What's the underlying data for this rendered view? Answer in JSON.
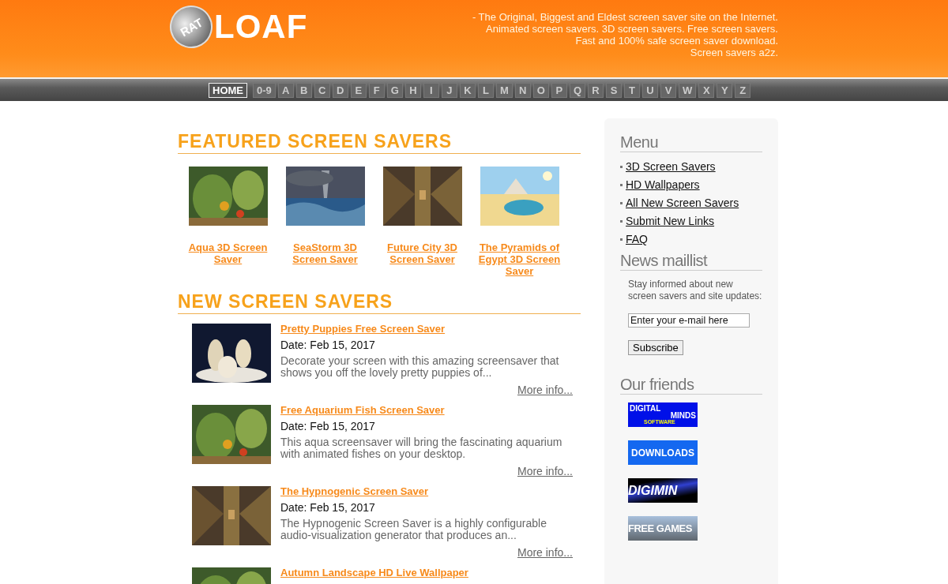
{
  "logo": {
    "badge": "RAT",
    "word": "LOAF"
  },
  "tagline": [
    "- The Original, Biggest and Eldest screen saver site on the Internet.",
    "Animated screen savers. 3D screen savers. Free screen savers.",
    "Fast and 100% safe screen saver download.",
    "Screen savers a2z."
  ],
  "nav": [
    {
      "label": "HOME",
      "selected": true
    },
    {
      "label": "0-9",
      "selected": false
    },
    {
      "label": "A",
      "selected": false
    },
    {
      "label": "B",
      "selected": false
    },
    {
      "label": "C",
      "selected": false
    },
    {
      "label": "D",
      "selected": false
    },
    {
      "label": "E",
      "selected": false
    },
    {
      "label": "F",
      "selected": false
    },
    {
      "label": "G",
      "selected": false
    },
    {
      "label": "H",
      "selected": false
    },
    {
      "label": "I",
      "selected": false
    },
    {
      "label": "J",
      "selected": false
    },
    {
      "label": "K",
      "selected": false
    },
    {
      "label": "L",
      "selected": false
    },
    {
      "label": "M",
      "selected": false
    },
    {
      "label": "N",
      "selected": false
    },
    {
      "label": "O",
      "selected": false
    },
    {
      "label": "P",
      "selected": false
    },
    {
      "label": "Q",
      "selected": false
    },
    {
      "label": "R",
      "selected": false
    },
    {
      "label": "S",
      "selected": false
    },
    {
      "label": "T",
      "selected": false
    },
    {
      "label": "U",
      "selected": false
    },
    {
      "label": "V",
      "selected": false
    },
    {
      "label": "W",
      "selected": false
    },
    {
      "label": "X",
      "selected": false
    },
    {
      "label": "Y",
      "selected": false
    },
    {
      "label": "Z",
      "selected": false
    }
  ],
  "featured": {
    "heading": "FEATURED SCREEN SAVERS",
    "items": [
      {
        "title": "Aqua 3D Screen Saver"
      },
      {
        "title": "SeaStorm 3D Screen Saver"
      },
      {
        "title": "Future City 3D Screen Saver"
      },
      {
        "title": "The Pyramids of Egypt 3D Screen Saver"
      }
    ]
  },
  "new": {
    "heading": "NEW SCREEN SAVERS",
    "items": [
      {
        "title": "Pretty Puppies Free Screen Saver",
        "date": "Date: Feb 15, 2017",
        "description": "Decorate your screen with this amazing screensaver that shows you off the lovely pretty puppies of...",
        "more": "More info..."
      },
      {
        "title": "Free Aquarium Fish Screen Saver",
        "date": "Date: Feb 15, 2017",
        "description": "This aqua screensaver will bring the fascinating aquarium with animated fishes on your desktop.",
        "more": "More info..."
      },
      {
        "title": "The Hypnogenic Screen Saver",
        "date": "Date: Feb 15, 2017",
        "description": "The Hypnogenic Screen Saver is a highly configurable audio-visualization generator that produces an...",
        "more": "More info..."
      },
      {
        "title": "Autumn Landscape HD Live Wallpaper"
      }
    ]
  },
  "sidebar": {
    "menu_heading": "Menu",
    "menu": [
      "3D Screen Savers",
      "HD Wallpapers",
      "All New Screen Savers",
      "Submit New Links",
      "FAQ"
    ],
    "maillist_heading": "News maillist",
    "maillist_text": "Stay informed about new screen savers and site updates:",
    "email": {
      "placeholder": "Enter your e-mail here"
    },
    "subscribe": "Subscribe",
    "friends_heading": "Our friends",
    "friends": [
      {
        "kind": "digital",
        "lines": [
          "DIGITAL",
          "MINDS",
          "SOFTWARE"
        ]
      },
      {
        "kind": "downloads",
        "lines": [
          "DOWNLOADS"
        ]
      },
      {
        "kind": "digimind",
        "lines": [
          "DIGIMIN"
        ]
      },
      {
        "kind": "games",
        "lines": [
          "FREE GAMES"
        ]
      }
    ]
  }
}
